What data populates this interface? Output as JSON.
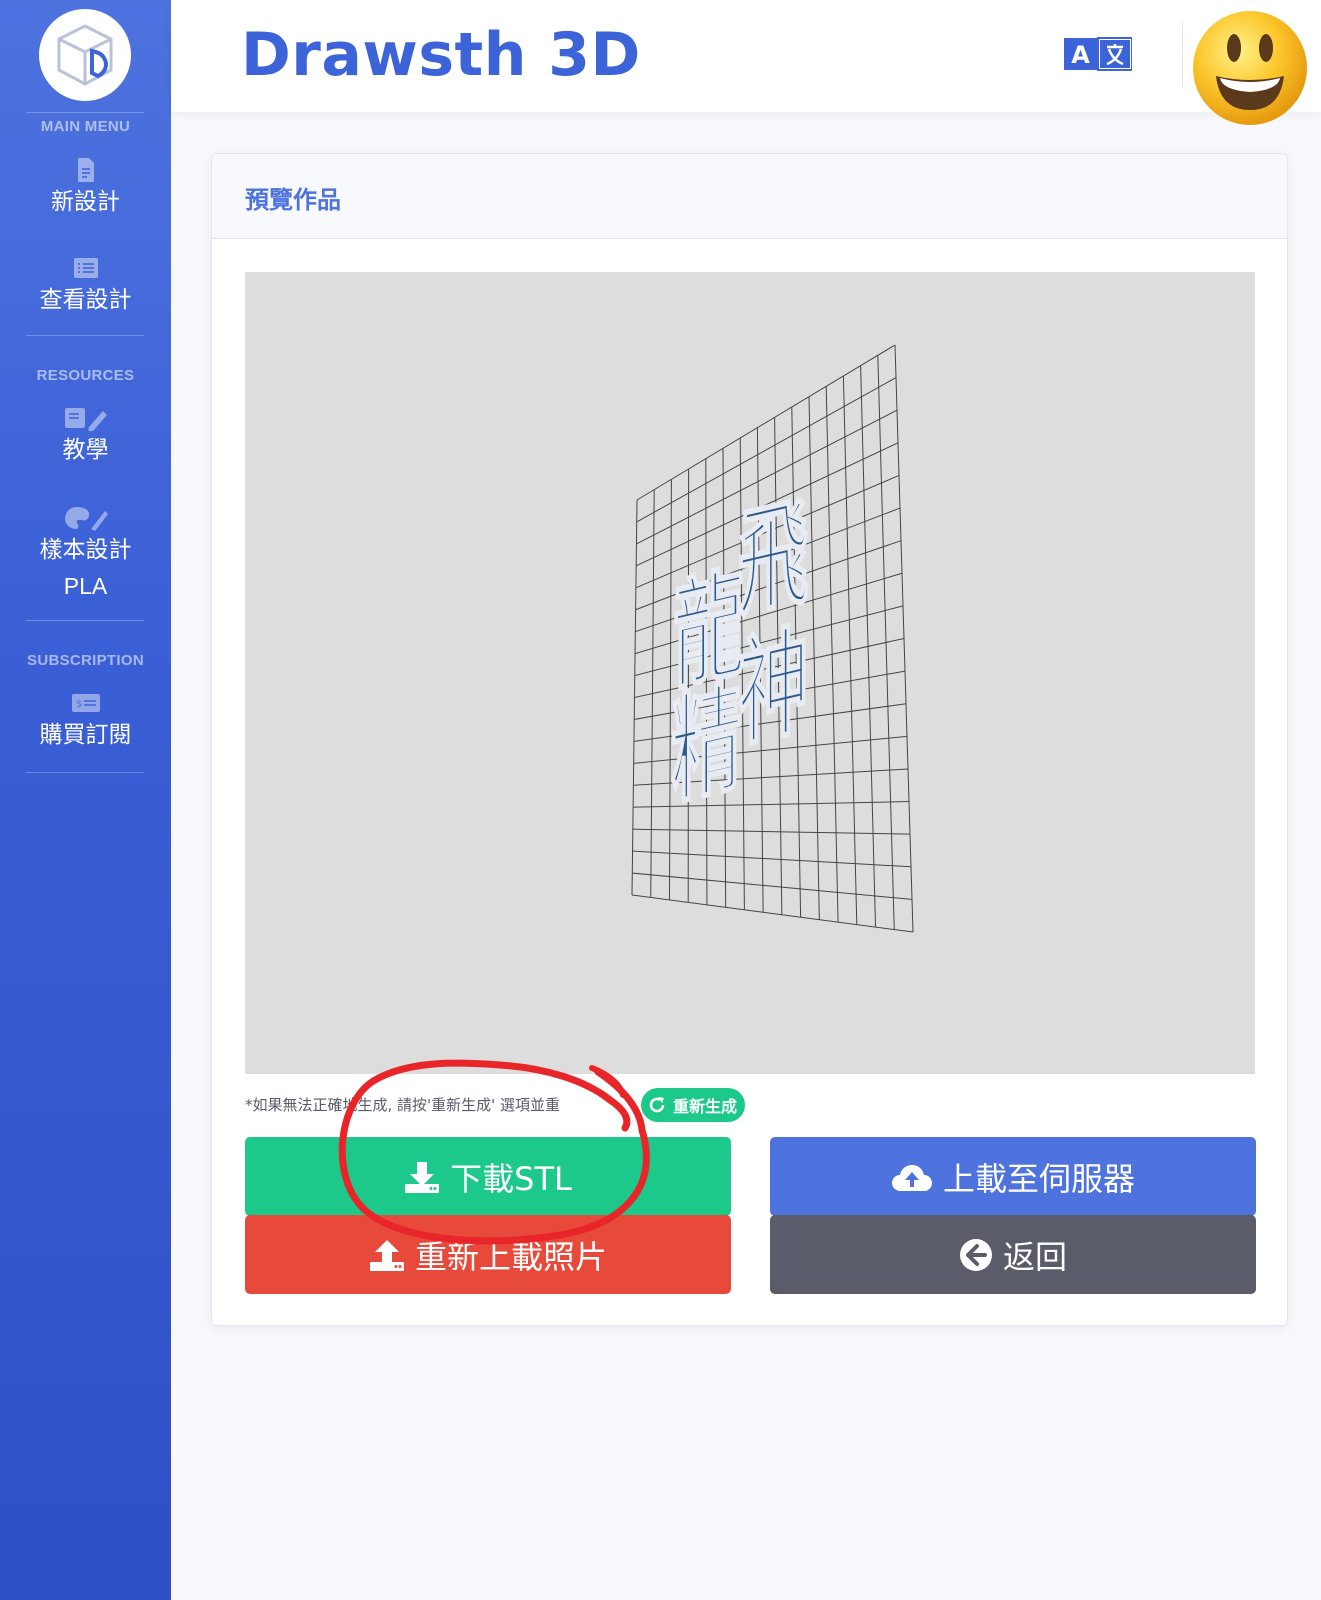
{
  "sidebar": {
    "logo_icon": "cube-d-logo-icon",
    "main_menu_heading": "MAIN MENU",
    "main_items": [
      {
        "label": "新設計",
        "icon": "file-icon"
      },
      {
        "label": "查看設計",
        "icon": "list-icon"
      }
    ],
    "resources_heading": "RESOURCES",
    "resource_items": [
      {
        "label": "教學",
        "icon": "book-pencil-icon"
      },
      {
        "label": "樣本設計",
        "label2": "PLA",
        "icon": "palette-brush-icon"
      }
    ],
    "subscription_heading": "SUBSCRIPTION",
    "subscription_items": [
      {
        "label": "購買訂閱",
        "icon": "money-card-icon"
      }
    ]
  },
  "header": {
    "brand": "Drawsth 3D",
    "language_icon": "translate-icon",
    "avatar_icon": "smiley-face-icon"
  },
  "card": {
    "title": "預覽作品",
    "hint": "*如果無法正確地生成, 請按'重新生成' 選項並重",
    "regenerate_label": "重新生成",
    "buttons": {
      "download": "下載STL",
      "upload_server": "上載至伺服器",
      "reupload": "重新上載照片",
      "back": "返回"
    }
  },
  "colors": {
    "sidebar": "#4e73df",
    "success": "#1cc88a",
    "primary": "#4e73df",
    "danger": "#e74a3b",
    "secondary": "#5a5c69",
    "annotation": "#e8262a"
  }
}
